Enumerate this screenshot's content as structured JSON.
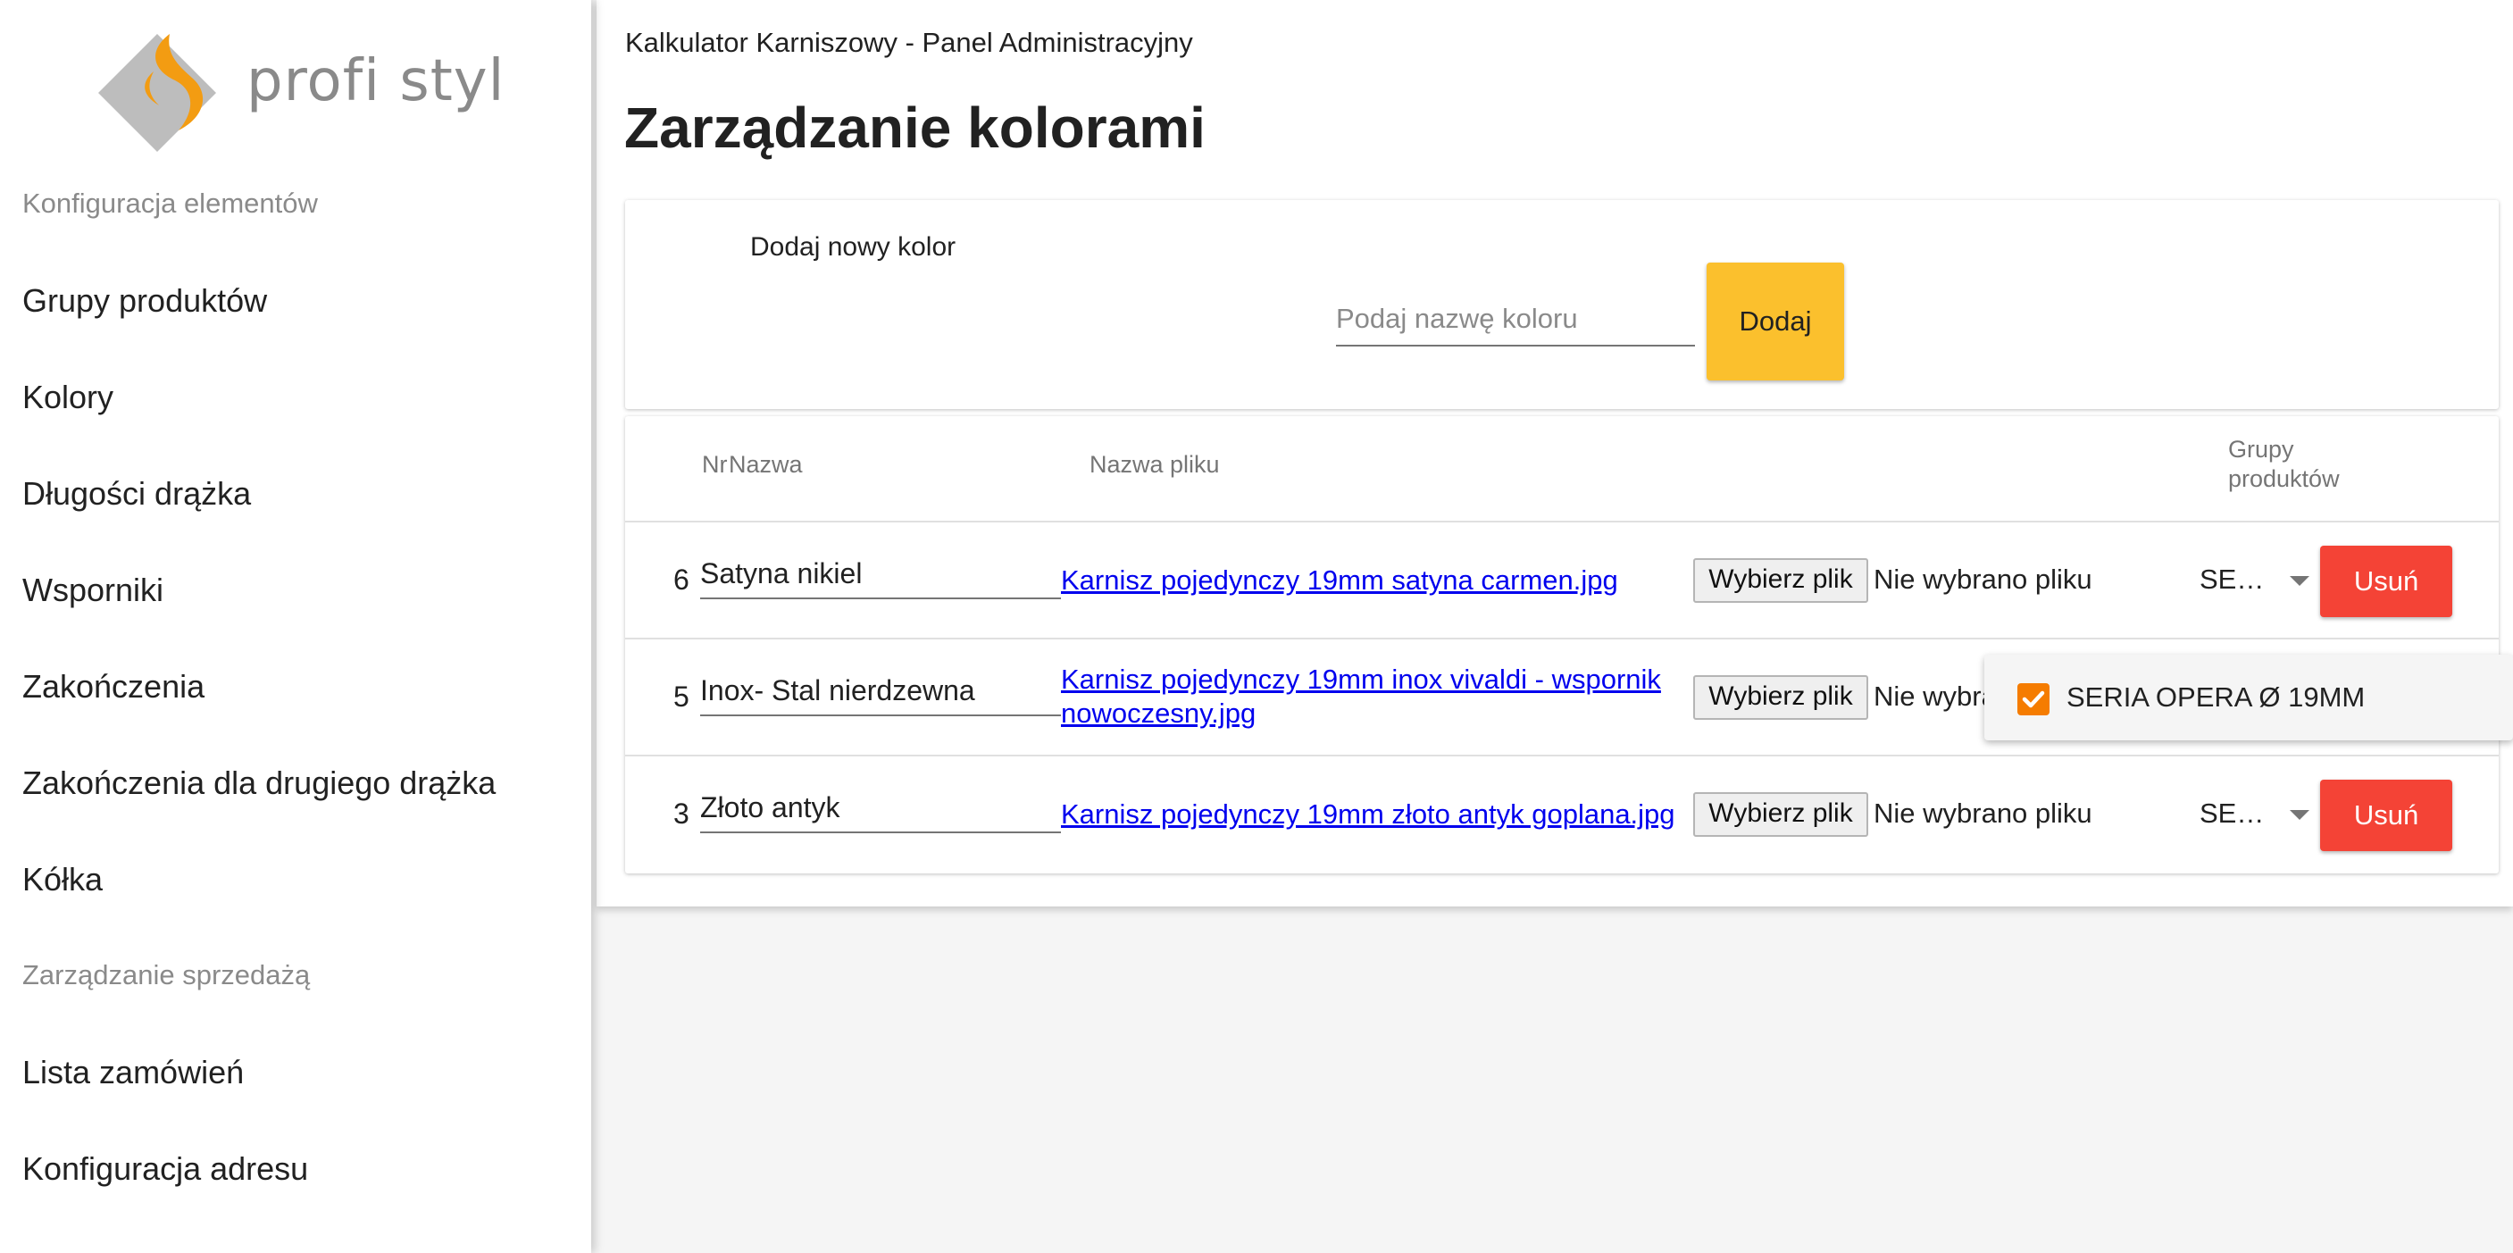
{
  "logo": {
    "text": "profi styl",
    "icon": "profi-styl-logo"
  },
  "sidebar": {
    "sections": [
      {
        "title": "Konfiguracja elementów",
        "items": [
          "Grupy produktów",
          "Kolory",
          "Długości drążka",
          "Wsporniki",
          "Zakończenia",
          "Zakończenia dla drugiego drążka",
          "Kółka"
        ]
      },
      {
        "title": "Zarządzanie sprzedażą",
        "items": [
          "Lista zamówień",
          "Konfiguracja adresu"
        ]
      }
    ]
  },
  "header": {
    "app_title": "Kalkulator Karniszowy - Panel Administracyjny",
    "page_title": "Zarządzanie kolorami"
  },
  "add_form": {
    "label": "Dodaj nowy kolor",
    "placeholder": "Podaj nazwę koloru",
    "value": "",
    "button": "Dodaj"
  },
  "table": {
    "columns": {
      "nr": "Nr",
      "name": "Nazwa",
      "file": "Nazwa pliku",
      "groups_line1": "Grupy",
      "groups_line2": "produktów"
    },
    "rows": [
      {
        "nr": "6",
        "name": "Satyna nikiel",
        "file_line1": "Karnisz pojedynczy 19mm satyna carmen.jpg",
        "file_line2": "",
        "file_button": "Wybierz plik",
        "file_status": "Nie wybrano pliku",
        "group": "SE…",
        "delete": "Usuń"
      },
      {
        "nr": "5",
        "name": "Inox- Stal nierdzewna",
        "file_line1": "Karnisz pojedynczy 19mm inox vivaldi - wspornik",
        "file_line2": "nowoczesny.jpg",
        "file_button": "Wybierz plik",
        "file_status": "Nie wybra",
        "group": "",
        "delete": ""
      },
      {
        "nr": "3",
        "name": "Złoto antyk",
        "file_line1": "Karnisz pojedynczy 19mm złoto antyk goplana.jpg",
        "file_line2": "",
        "file_button": "Wybierz plik",
        "file_status": "Nie wybrano pliku",
        "group": "SE…",
        "delete": "Usuń"
      }
    ]
  },
  "dropdown": {
    "options": [
      {
        "label": "SERIA OPERA Ø 19MM",
        "checked": true
      }
    ]
  },
  "colors": {
    "accent_yellow": "#fbc02d",
    "delete_red": "#f44336",
    "checkbox_orange": "#f57c00",
    "link_blue": "#0000ee",
    "logo_orange": "#f39c12",
    "logo_gray": "#bdbdbd"
  }
}
